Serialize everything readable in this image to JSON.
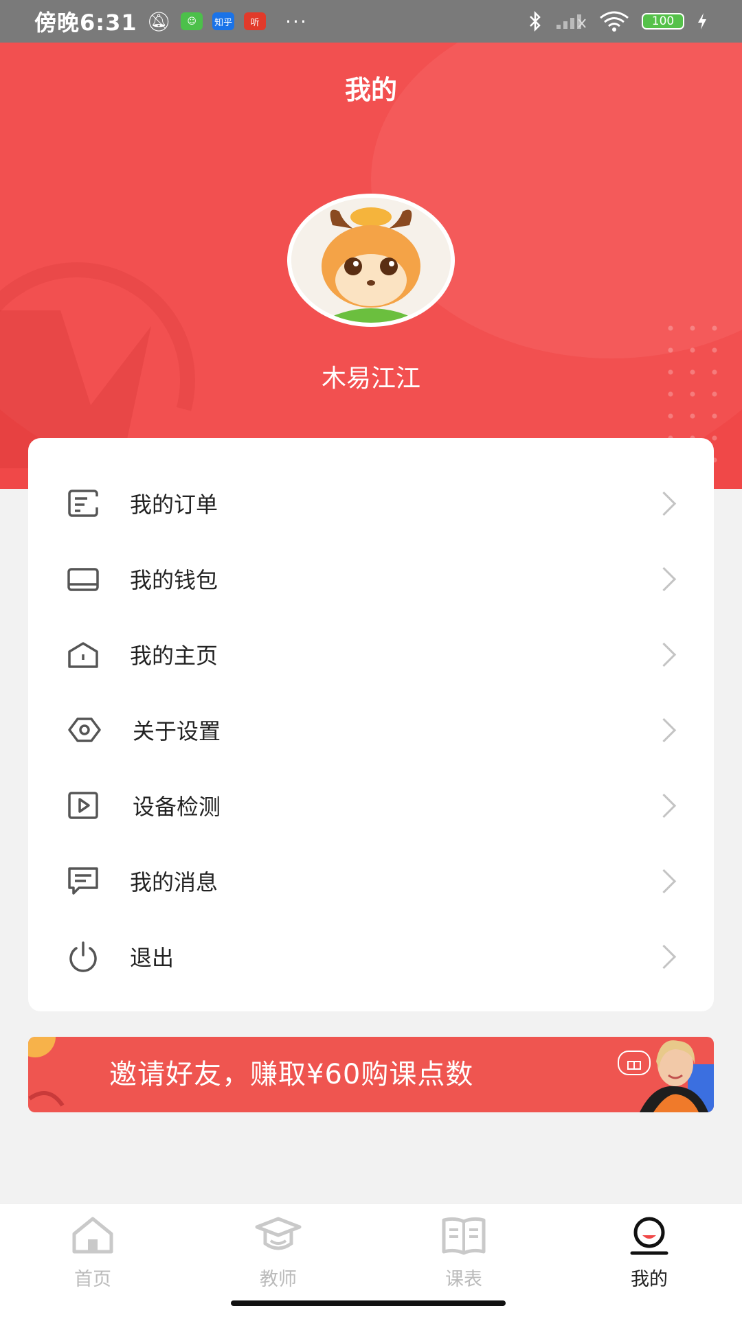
{
  "status_bar": {
    "time": "傍晚6:31",
    "app1": "",
    "app2": "知乎",
    "app3": "听",
    "more": "···",
    "battery": "100"
  },
  "header": {
    "title": "我的",
    "username": "木易江江"
  },
  "menu": {
    "items": [
      {
        "label": "我的订单",
        "icon": "order-icon"
      },
      {
        "label": "我的钱包",
        "icon": "wallet-icon"
      },
      {
        "label": "我的主页",
        "icon": "home-page-icon"
      },
      {
        "label": "关于设置",
        "icon": "settings-icon"
      },
      {
        "label": "设备检测",
        "icon": "device-check-icon"
      },
      {
        "label": "我的消息",
        "icon": "message-icon"
      },
      {
        "label": "退出",
        "icon": "power-icon"
      }
    ]
  },
  "banner": {
    "text": "邀请好友，赚取¥60购课点数"
  },
  "tabbar": {
    "tabs": [
      {
        "label": "首页",
        "icon": "home-icon"
      },
      {
        "label": "教师",
        "icon": "graduation-cap-icon"
      },
      {
        "label": "课表",
        "icon": "book-icon"
      },
      {
        "label": "我的",
        "icon": "profile-icon"
      }
    ],
    "active_index": 3
  },
  "colors": {
    "primary": "#f04848",
    "text": "#222222",
    "inactive": "#bbbbbb"
  }
}
